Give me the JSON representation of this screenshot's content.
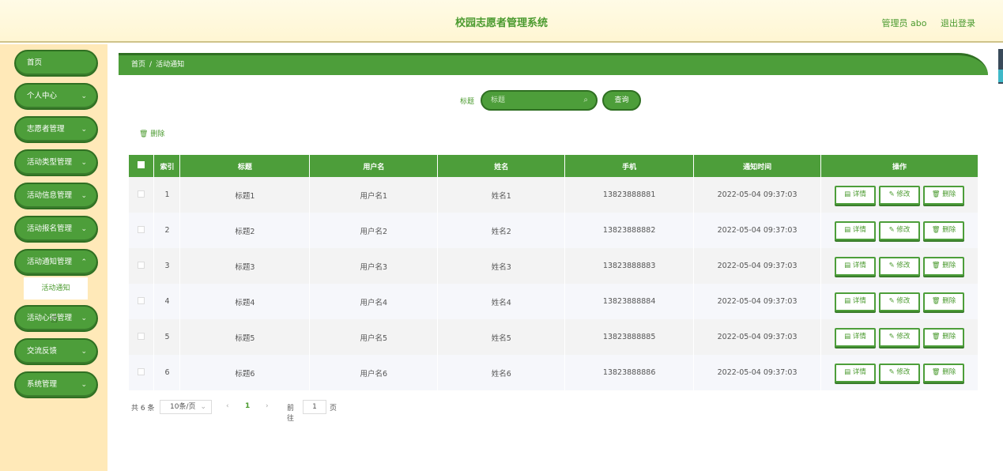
{
  "header": {
    "title": "校园志愿者管理系统",
    "user": "管理员 abo",
    "logout": "退出登录"
  },
  "sidebar": {
    "items": [
      {
        "label": "首页",
        "has_children": false
      },
      {
        "label": "个人中心",
        "has_children": true
      },
      {
        "label": "志愿者管理",
        "has_children": true
      },
      {
        "label": "活动类型管理",
        "has_children": true
      },
      {
        "label": "活动信息管理",
        "has_children": true
      },
      {
        "label": "活动报名管理",
        "has_children": true
      },
      {
        "label": "活动通知管理",
        "has_children": true,
        "expanded": true
      },
      {
        "label": "活动心得管理",
        "has_children": true
      },
      {
        "label": "交流反馈",
        "has_children": true
      },
      {
        "label": "系统管理",
        "has_children": true
      }
    ],
    "subitem": "活动通知"
  },
  "breadcrumb": {
    "home": "首页",
    "separator": "/",
    "current": "活动通知"
  },
  "search": {
    "label": "标题",
    "placeholder": "标题",
    "button": "查询"
  },
  "toolbar": {
    "delete_label": "删除"
  },
  "table": {
    "headers": [
      "索引",
      "标题",
      "用户名",
      "姓名",
      "手机",
      "通知时间",
      "操作"
    ],
    "rows": [
      {
        "index": "1",
        "title": "标题1",
        "username": "用户名1",
        "name": "姓名1",
        "phone": "13823888881",
        "time": "2022-05-04 09:37:03"
      },
      {
        "index": "2",
        "title": "标题2",
        "username": "用户名2",
        "name": "姓名2",
        "phone": "13823888882",
        "time": "2022-05-04 09:37:03"
      },
      {
        "index": "3",
        "title": "标题3",
        "username": "用户名3",
        "name": "姓名3",
        "phone": "13823888883",
        "time": "2022-05-04 09:37:03"
      },
      {
        "index": "4",
        "title": "标题4",
        "username": "用户名4",
        "name": "姓名4",
        "phone": "13823888884",
        "time": "2022-05-04 09:37:03"
      },
      {
        "index": "5",
        "title": "标题5",
        "username": "用户名5",
        "name": "姓名5",
        "phone": "13823888885",
        "time": "2022-05-04 09:37:03"
      },
      {
        "index": "6",
        "title": "标题6",
        "username": "用户名6",
        "name": "姓名6",
        "phone": "13823888886",
        "time": "2022-05-04 09:37:03"
      }
    ],
    "actions": {
      "detail": "详情",
      "edit": "修改",
      "delete": "删除"
    }
  },
  "pagination": {
    "total": "共 6 条",
    "page_size": "10条/页",
    "current": "1",
    "goto_label": "前往",
    "goto_value": "1",
    "page_label": "页"
  },
  "colors": {
    "primary": "#4d9e3a",
    "sidebar_bg": "#ffe9b8",
    "header_bg": "#fffbe6"
  }
}
